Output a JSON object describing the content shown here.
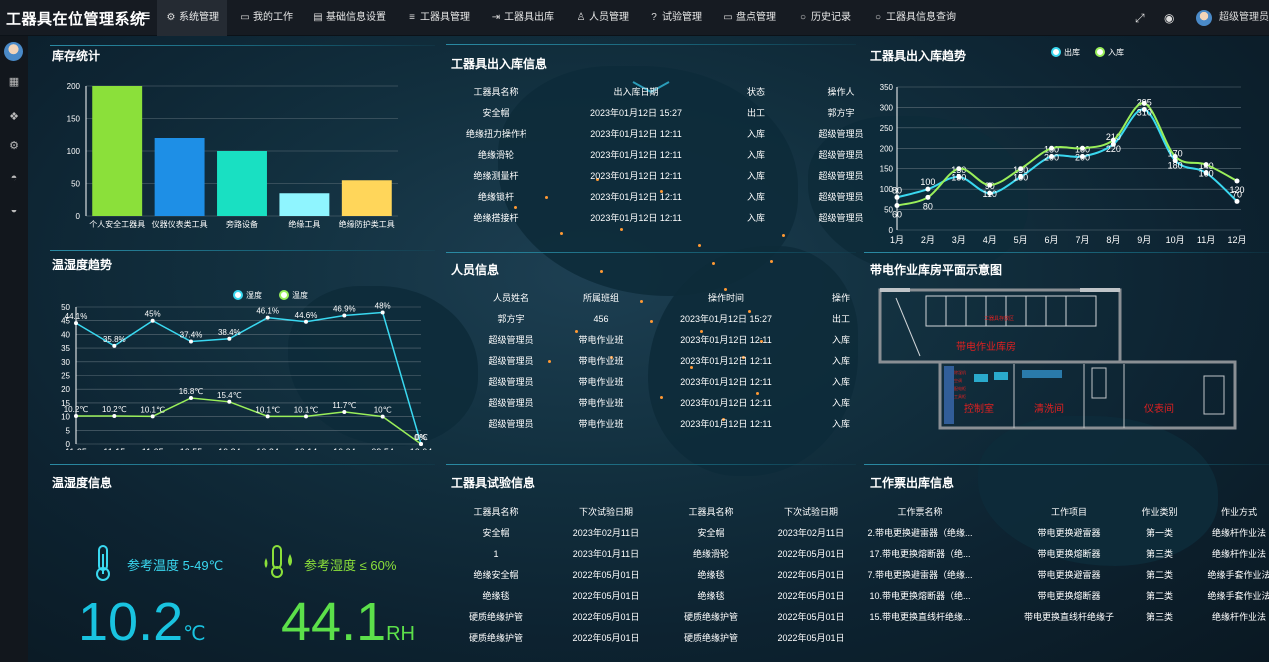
{
  "app": {
    "title": "工器具在位管理系统"
  },
  "nav": [
    {
      "label": "系统管理",
      "icon": "gear-icon",
      "glyph": "⚙"
    },
    {
      "label": "我的工作",
      "icon": "monitor-icon",
      "glyph": "▭"
    },
    {
      "label": "基础信息设置",
      "icon": "document-icon",
      "glyph": "▤"
    },
    {
      "label": "工器具管理",
      "icon": "list-icon",
      "glyph": "≡"
    },
    {
      "label": "工器具出库",
      "icon": "export-icon",
      "glyph": "⇥"
    },
    {
      "label": "人员管理",
      "icon": "users-icon",
      "glyph": "♙"
    },
    {
      "label": "试验管理",
      "icon": "question-icon",
      "glyph": "?"
    },
    {
      "label": "盘点管理",
      "icon": "monitor-icon",
      "glyph": "▭"
    },
    {
      "label": "历史记录",
      "icon": "circle-icon",
      "glyph": "○"
    },
    {
      "label": "工器具信息查询",
      "icon": "circle-icon",
      "glyph": "○"
    }
  ],
  "user": {
    "name": "超级管理员"
  },
  "inventory": {
    "title": "库存统计",
    "chart_data": {
      "type": "bar",
      "categories": [
        "个人安全工器具",
        "仪器仪表类工具",
        "旁路设备",
        "绝缘工具",
        "绝缘防护类工具"
      ],
      "values": [
        200,
        120,
        100,
        35,
        55
      ],
      "ylim": [
        0,
        200
      ],
      "yticks": [
        0,
        50,
        100,
        150,
        200
      ],
      "colors": [
        "#8be03a",
        "#1e8fe6",
        "#19e0c2",
        "#8ff5ff",
        "#ffd65a"
      ]
    }
  },
  "inout": {
    "title": "工器具出入库信息",
    "headers": [
      "工器具名称",
      "出入库日期",
      "状态",
      "操作人"
    ],
    "rows": [
      [
        "安全帽",
        "2023年01月12日 15:27",
        "出工",
        "郭方宇"
      ],
      [
        "绝缘扭力操作杆",
        "2023年01月12日 12:11",
        "入库",
        "超级管理员"
      ],
      [
        "绝缘滑轮",
        "2023年01月12日 12:11",
        "入库",
        "超级管理员"
      ],
      [
        "绝缘测量杆",
        "2023年01月12日 12:11",
        "入库",
        "超级管理员"
      ],
      [
        "绝缘锁杆",
        "2023年01月12日 12:11",
        "入库",
        "超级管理员"
      ],
      [
        "绝缘搭接杆",
        "2023年01月12日 12:11",
        "入库",
        "超级管理员"
      ]
    ]
  },
  "trend": {
    "title": "工器具出入库趋势",
    "chart_data": {
      "type": "line",
      "categories": [
        "1月",
        "2月",
        "3月",
        "4月",
        "5月",
        "6月",
        "7月",
        "8月",
        "9月",
        "10月",
        "11月",
        "12月"
      ],
      "ylim": [
        0,
        350
      ],
      "yticks": [
        0,
        50,
        100,
        150,
        200,
        250,
        300,
        350
      ],
      "series": [
        {
          "name": "出库",
          "color": "#3ad8f0",
          "values": [
            80,
            100,
            130,
            90,
            130,
            180,
            180,
            210,
            295,
            170,
            140,
            70
          ]
        },
        {
          "name": "入库",
          "color": "#9aef5a",
          "values": [
            60,
            80,
            150,
            110,
            150,
            200,
            200,
            220,
            310,
            180,
            160,
            120
          ]
        }
      ]
    }
  },
  "env": {
    "title": "温湿度趋势",
    "chart_data": {
      "type": "line",
      "categories": [
        "11:25",
        "11:15",
        "11:05",
        "10:55",
        "10:34",
        "10:24",
        "10:14",
        "10:04",
        "09:54",
        "10:04"
      ],
      "ylim": [
        0,
        50
      ],
      "yticks": [
        0,
        5,
        10,
        15,
        20,
        25,
        30,
        35,
        40,
        45,
        50
      ],
      "series": [
        {
          "name": "湿度",
          "color": "#3ad8f0",
          "values": [
            44.1,
            35.8,
            45,
            37.4,
            38.4,
            46.1,
            44.6,
            46.9,
            48,
            0
          ],
          "labels": [
            "44.1%",
            "35.8%",
            "45%",
            "37.4%",
            "38.4%",
            "46.1%",
            "44.6%",
            "46.9%",
            "48%",
            "0%"
          ]
        },
        {
          "name": "温度",
          "color": "#9aef5a",
          "values": [
            10.2,
            10.2,
            10.1,
            16.8,
            15.4,
            10.1,
            10.1,
            11.7,
            10,
            0
          ],
          "labels": [
            "10.2℃",
            "10.2℃",
            "10.1℃",
            "16.8℃",
            "15.4℃",
            "10.1℃",
            "10.1℃",
            "11.7℃",
            "10℃",
            "0℃"
          ]
        }
      ]
    }
  },
  "personnel": {
    "title": "人员信息",
    "headers": [
      "人员姓名",
      "所属班组",
      "操作时间",
      "操作"
    ],
    "rows": [
      [
        "郭方宇",
        "456",
        "2023年01月12日 15:27",
        "出工"
      ],
      [
        "超级管理员",
        "带电作业班",
        "2023年01月12日 12:11",
        "入库"
      ],
      [
        "超级管理员",
        "带电作业班",
        "2023年01月12日 12:11",
        "入库"
      ],
      [
        "超级管理员",
        "带电作业班",
        "2023年01月12日 12:11",
        "入库"
      ],
      [
        "超级管理员",
        "带电作业班",
        "2023年01月12日 12:11",
        "入库"
      ],
      [
        "超级管理员",
        "带电作业班",
        "2023年01月12日 12:11",
        "入库"
      ]
    ]
  },
  "floorplan": {
    "title": "带电作业库房平面示意图",
    "room_main": "带电作业库房",
    "room_small": "工器具存放区",
    "room_control": "控制室",
    "room_wash": "清洗间",
    "room_meter": "仪表间",
    "labels_small": [
      "除湿机",
      "空调",
      "配电柜",
      "工具柜"
    ]
  },
  "env_info": {
    "title": "温湿度信息",
    "temp_ref": "参考温度 5-49℃",
    "hum_ref": "参考湿度 ≤ 60%",
    "temp_value": "10.2",
    "temp_unit": "℃",
    "hum_value": "44.1",
    "hum_unit": "RH"
  },
  "tests": {
    "title": "工器具试验信息",
    "headers": [
      "工器具名称",
      "下次试验日期",
      "工器具名称",
      "下次试验日期"
    ],
    "rows": [
      [
        "安全帽",
        "2023年02月11日",
        "安全帽",
        "2023年02月11日"
      ],
      [
        "1",
        "2023年01月11日",
        "绝缘滑轮",
        "2022年05月01日"
      ],
      [
        "绝缘安全帽",
        "2022年05月01日",
        "绝缘毯",
        "2022年05月01日"
      ],
      [
        "绝缘毯",
        "2022年05月01日",
        "绝缘毯",
        "2022年05月01日"
      ],
      [
        "硬质绝缘护管",
        "2022年05月01日",
        "硬质绝缘护管",
        "2022年05月01日"
      ],
      [
        "硬质绝缘护管",
        "2022年05月01日",
        "硬质绝缘护管",
        "2022年05月01日"
      ]
    ]
  },
  "tickets": {
    "title": "工作票出库信息",
    "headers": [
      "工作票名称",
      "工作项目",
      "作业类别",
      "作业方式"
    ],
    "rows": [
      [
        "2.带电更换避雷器（绝缘...",
        "带电更换避雷器",
        "第一类",
        "绝缘杆作业法"
      ],
      [
        "17.带电更换熔断器（绝...",
        "带电更换熔断器",
        "第三类",
        "绝缘杆作业法"
      ],
      [
        "7.带电更换避雷器（绝缘...",
        "带电更换避雷器",
        "第二类",
        "绝缘手套作业法"
      ],
      [
        "10.带电更换熔断器（绝...",
        "带电更换熔断器",
        "第二类",
        "绝缘手套作业法"
      ],
      [
        "15.带电更换直线杆绝缘...",
        "带电更换直线杆绝缘子",
        "第三类",
        "绝缘杆作业法"
      ]
    ]
  }
}
